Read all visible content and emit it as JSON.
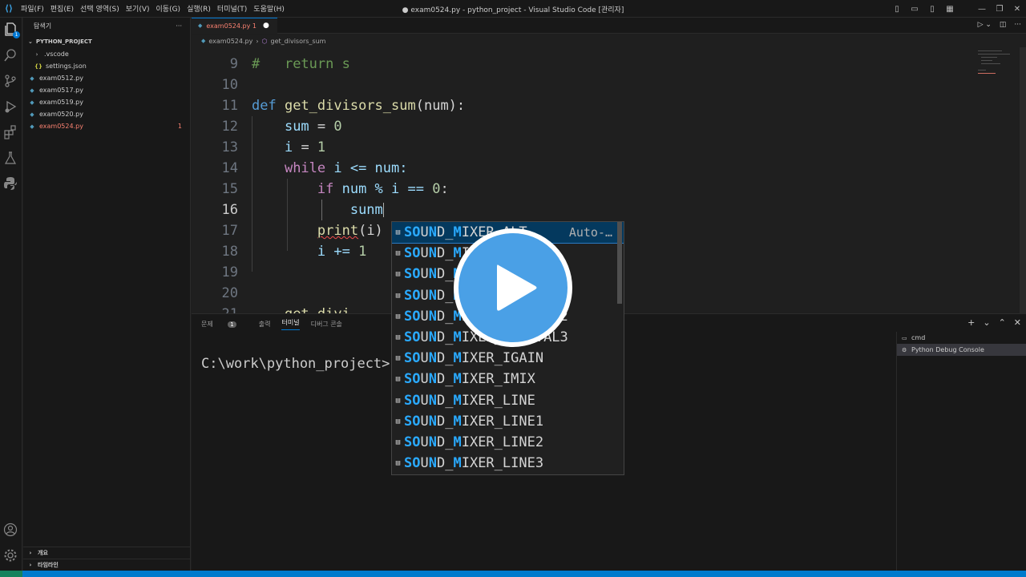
{
  "titlebar": {
    "menus": [
      "파일(F)",
      "편집(E)",
      "선택 영역(S)",
      "보기(V)",
      "이동(G)",
      "실행(R)",
      "터미널(T)",
      "도움말(H)"
    ],
    "title": "● exam0524.py - python_project - Visual Studio Code [관리자]"
  },
  "activity": {
    "explorer_badge": "1"
  },
  "sidebar": {
    "header": "탐색기",
    "more": "···",
    "project": "PYTHON_PROJECT",
    "folder": ".vscode",
    "settings": "settings.json",
    "files": [
      "exam0512.py",
      "exam0517.py",
      "exam0519.py",
      "exam0520.py",
      "exam0524.py"
    ],
    "selected_count": "1",
    "outline": "개요",
    "timeline": "타임라인"
  },
  "tab": {
    "label": "exam0524.py 1",
    "dirty": "●"
  },
  "breadcrumb": {
    "file": "exam0524.py",
    "symbol": "get_divisors_sum"
  },
  "editor": {
    "lines": [
      {
        "n": "9"
      },
      {
        "n": "10"
      },
      {
        "n": "11"
      },
      {
        "n": "12"
      },
      {
        "n": "13"
      },
      {
        "n": "14"
      },
      {
        "n": "15"
      },
      {
        "n": "16"
      },
      {
        "n": "17"
      },
      {
        "n": "18"
      },
      {
        "n": "19"
      },
      {
        "n": "20"
      },
      {
        "n": "21"
      }
    ],
    "code": {
      "l9_hash": "#",
      "l9_text": "   return s",
      "l11_def": "def",
      "l11_fn": "get_divisors_sum",
      "l11_rest": "(num):",
      "l12_var": "sum",
      "l12_rest": " = ",
      "l12_num": "0",
      "l13_var": "i",
      "l13_rest": " = ",
      "l13_num": "1",
      "l14_kw": "while",
      "l14_rest": " i <= num:",
      "l15_kw": "if",
      "l15_rest": " num % i == ",
      "l15_num": "0",
      "l15_colon": ":",
      "l16_text": "sunm",
      "l17_fn": "print",
      "l17_rest": "(i)",
      "l18_text": "i += ",
      "l18_num": "1",
      "l21_text": "get_divi"
    }
  },
  "suggest": {
    "items": [
      {
        "hl1": "SO",
        "mid1": "U",
        "hl2": "N",
        "mid2": "D_",
        "hl3": "M",
        "rest": "IXER_ALT…",
        "detail": "Auto-…"
      },
      {
        "hl1": "SO",
        "mid1": "U",
        "hl2": "N",
        "mid2": "D_",
        "hl3": "M",
        "rest": "IXER_BASS",
        "detail": ""
      },
      {
        "hl1": "SO",
        "mid1": "U",
        "hl2": "N",
        "mid2": "D_",
        "hl3": "M",
        "rest": "IXER_CD",
        "detail": ""
      },
      {
        "hl1": "SO",
        "mid1": "U",
        "hl2": "N",
        "mid2": "D_",
        "hl3": "M",
        "rest": "IXER_DIGITAL1",
        "detail": ""
      },
      {
        "hl1": "SO",
        "mid1": "U",
        "hl2": "N",
        "mid2": "D_",
        "hl3": "M",
        "rest": "IXER_DIGITAL2",
        "detail": ""
      },
      {
        "hl1": "SO",
        "mid1": "U",
        "hl2": "N",
        "mid2": "D_",
        "hl3": "M",
        "rest": "IXER_DIGITAL3",
        "detail": ""
      },
      {
        "hl1": "SO",
        "mid1": "U",
        "hl2": "N",
        "mid2": "D_",
        "hl3": "M",
        "rest": "IXER_IGAIN",
        "detail": ""
      },
      {
        "hl1": "SO",
        "mid1": "U",
        "hl2": "N",
        "mid2": "D_",
        "hl3": "M",
        "rest": "IXER_IMIX",
        "detail": ""
      },
      {
        "hl1": "SO",
        "mid1": "U",
        "hl2": "N",
        "mid2": "D_",
        "hl3": "M",
        "rest": "IXER_LINE",
        "detail": ""
      },
      {
        "hl1": "SO",
        "mid1": "U",
        "hl2": "N",
        "mid2": "D_",
        "hl3": "M",
        "rest": "IXER_LINE1",
        "detail": ""
      },
      {
        "hl1": "SO",
        "mid1": "U",
        "hl2": "N",
        "mid2": "D_",
        "hl3": "M",
        "rest": "IXER_LINE2",
        "detail": ""
      },
      {
        "hl1": "SO",
        "mid1": "U",
        "hl2": "N",
        "mid2": "D_",
        "hl3": "M",
        "rest": "IXER_LINE3",
        "detail": ""
      }
    ]
  },
  "panel": {
    "tabs": [
      "문제",
      "출력",
      "터미널",
      "디버그 콘솔"
    ],
    "problems_count": "1",
    "active_tab": "터미널",
    "terminal_text": "C:\\work\\python_project>",
    "terminals": [
      "cmd",
      "Python Debug Console"
    ]
  },
  "colors": {
    "accent": "#0078d4",
    "statusbar": "#007acc",
    "error": "#f88070",
    "play_button": "#4aa0e6"
  }
}
